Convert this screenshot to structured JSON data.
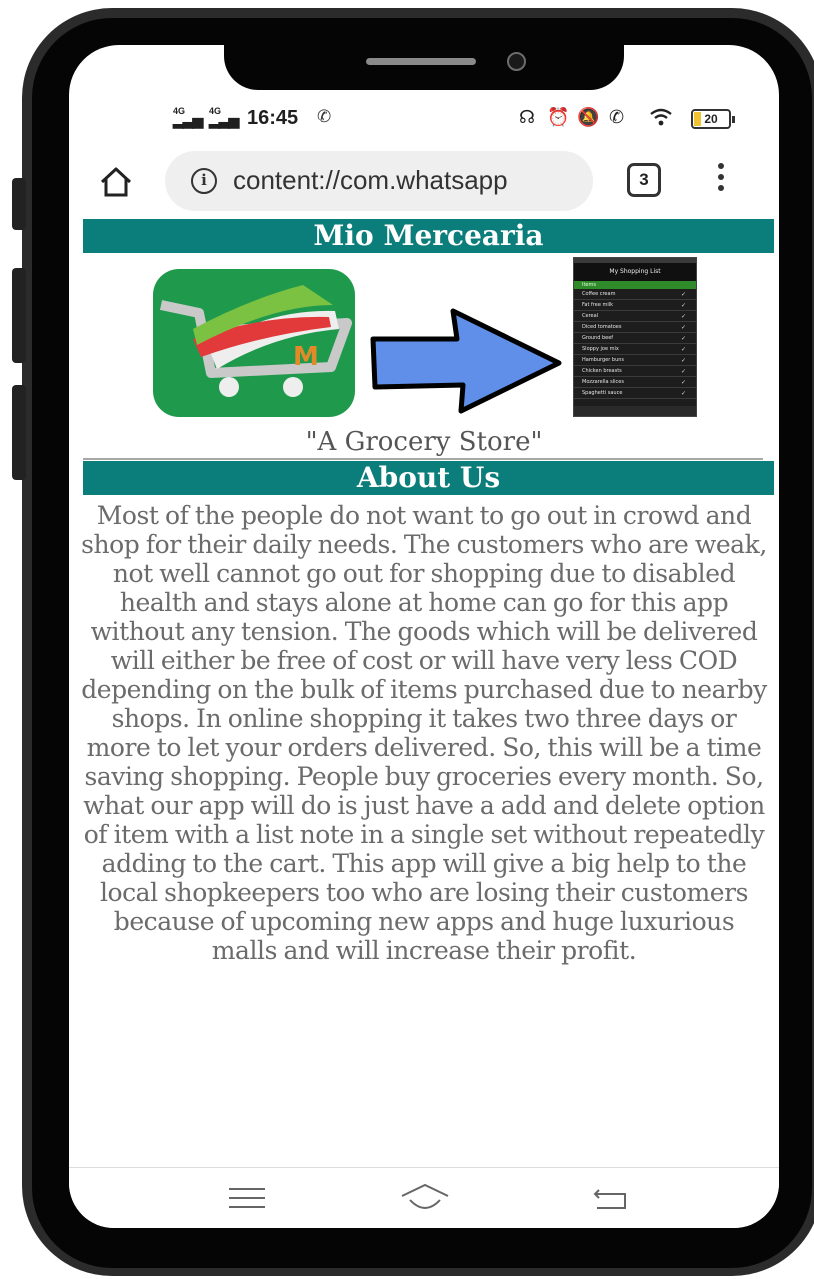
{
  "status_bar": {
    "signal_1": "4G",
    "signal_2": "4G",
    "time": "16:45",
    "battery": "20"
  },
  "browser": {
    "url": "content://com.whatsapp",
    "tab_count": "3"
  },
  "page": {
    "title": "Mio Mercearia",
    "tagline": "\"A Grocery Store\"",
    "about_heading": "About Us",
    "about_text": "Most of the people do not want to go out in crowd and shop for their daily needs. The customers who are weak, not well cannot go out for shopping due to disabled health and stays alone at home can go for this app without any tension. The goods which will be delivered will either be free of cost or will have very less COD depending on the bulk of items purchased due to nearby shops. In online shopping it takes two three days or more to let your orders delivered. So, this will be a time saving shopping. People buy groceries every month. So, what our app will do is just have a add and delete option of item with a list note in a single set without repeatedly adding to the cart. This app will give a big help to the local shopkeepers too who are losing their customers because of upcoming new apps and huge luxurious malls and will increase their profit."
  },
  "shopping_list_preview": {
    "title": "My Shopping List",
    "header": "Items",
    "items": [
      "Coffee cream",
      "Fat free milk",
      "Cereal",
      "Diced tomatoes",
      "Ground beef",
      "Sloppy joe mix",
      "Hamburger buns",
      "Chicken breasts",
      "Mozzarella slices",
      "Spaghetti sauce"
    ]
  },
  "colors": {
    "banner": "#0b7d7a",
    "logo_green": "#1f9a4c",
    "arrow_fill": "#5f8fe8",
    "body_text": "#6b6b6b"
  }
}
